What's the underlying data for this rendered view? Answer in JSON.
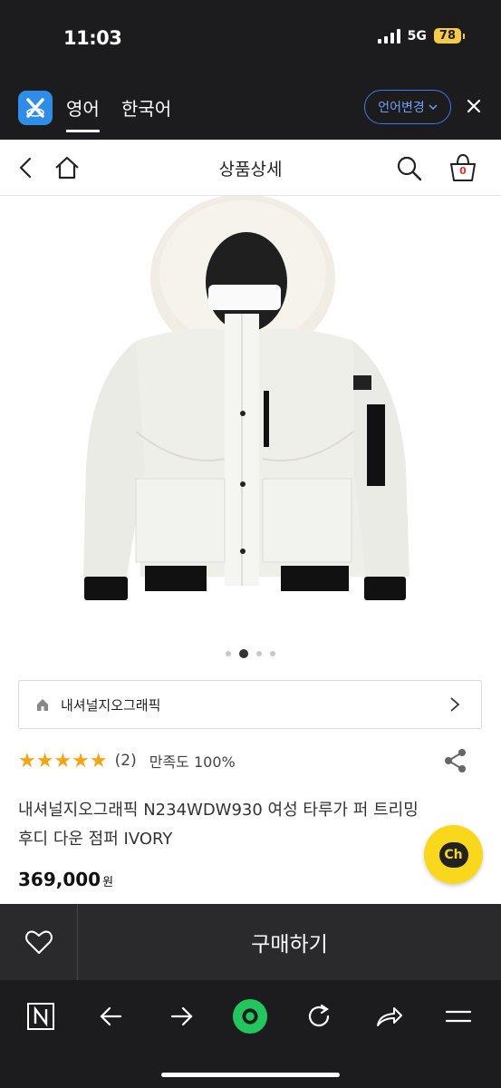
{
  "status": {
    "time": "11:03",
    "network": "5G",
    "battery": "78"
  },
  "translate": {
    "tab_active": "영어",
    "tab_other": "한국어",
    "change_label": "언어변경"
  },
  "header": {
    "title": "상품상세",
    "cart_count": "0"
  },
  "gallery": {
    "total": 4,
    "current": 2
  },
  "brand": {
    "name": "내셔널지오그래픽"
  },
  "rating": {
    "stars": "★★★★★",
    "count": "(2)",
    "satisfaction": "만족도 100%"
  },
  "product": {
    "name": "내셔널지오그래픽 N234WDW930 여성 타루가 퍼 트리밍 후디 다운 점퍼 IVORY",
    "price": "369,000",
    "currency": "원"
  },
  "chat": {
    "label": "Ch"
  },
  "buy": {
    "label": "구매하기"
  },
  "colors": {
    "background": "#1c1c1e",
    "accent_blue": "#2f8de8",
    "star": "#f2a516",
    "chat_yellow": "#f9d71c",
    "browser_green": "#22c55e"
  },
  "icons": [
    "back-icon",
    "home-icon",
    "search-icon",
    "cart-icon",
    "share-icon",
    "heart-icon",
    "naver-icon",
    "forward-icon",
    "refresh-icon"
  ]
}
